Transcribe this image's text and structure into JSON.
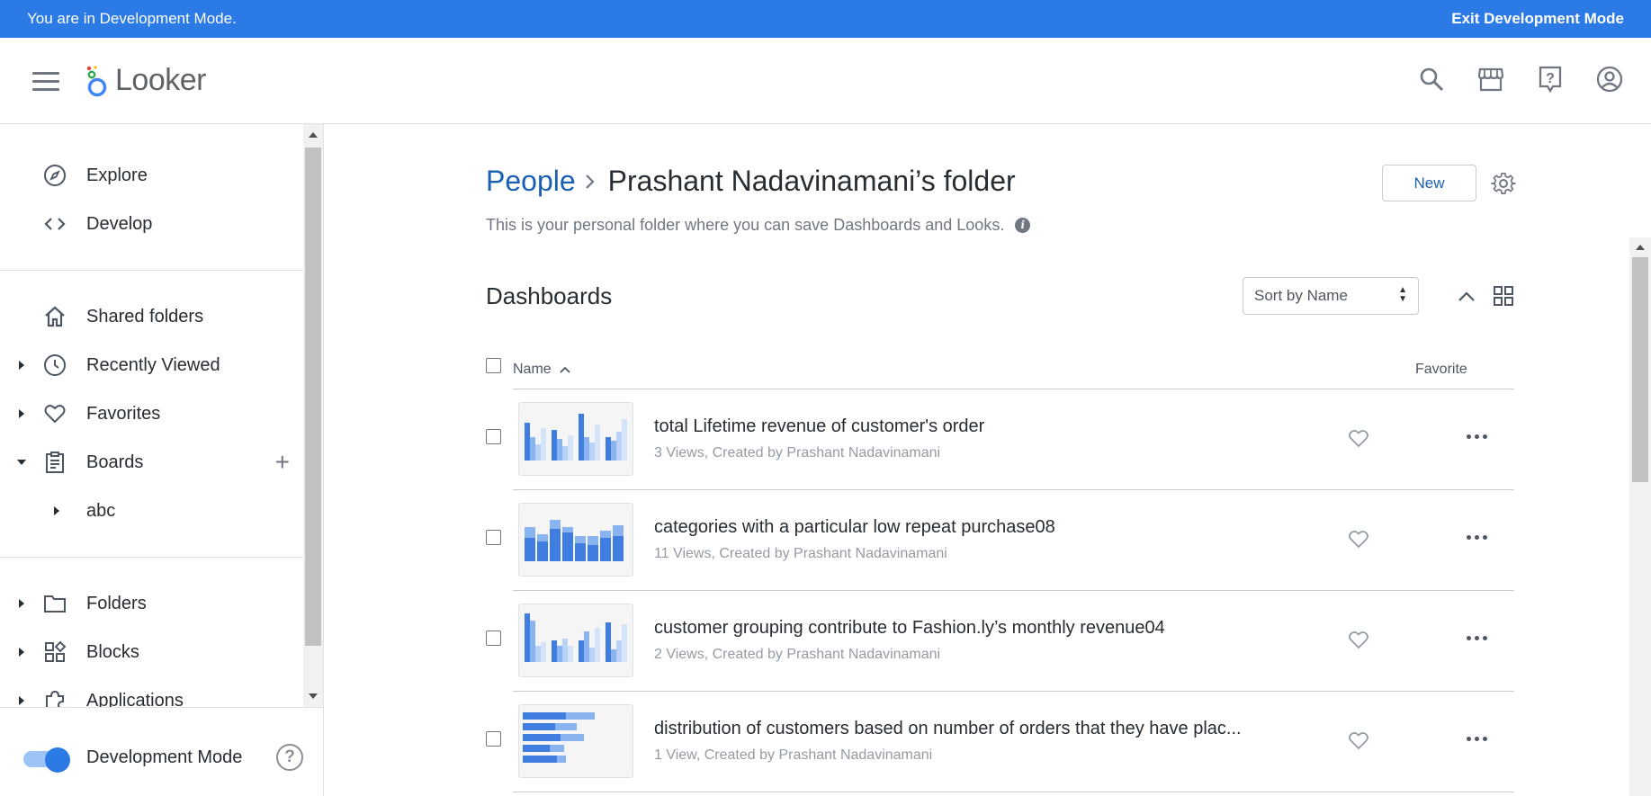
{
  "dev_banner": {
    "message": "You are in Development Mode.",
    "exit_label": "Exit Development Mode"
  },
  "header": {
    "logo_text": "Looker",
    "icons": [
      "search-icon",
      "marketplace-icon",
      "help-icon",
      "account-icon"
    ]
  },
  "sidebar": {
    "primary": [
      {
        "label": "Explore",
        "icon": "compass-icon"
      },
      {
        "label": "Develop",
        "icon": "code-icon"
      }
    ],
    "secondary": [
      {
        "label": "Shared folders",
        "icon": "home-icon"
      },
      {
        "label": "Recently Viewed",
        "icon": "clock-icon"
      },
      {
        "label": "Favorites",
        "icon": "heart-icon"
      },
      {
        "label": "Boards",
        "icon": "clipboard-icon"
      },
      {
        "label": "abc"
      }
    ],
    "tertiary": [
      {
        "label": "Folders",
        "icon": "folder-icon"
      },
      {
        "label": "Blocks",
        "icon": "blocks-icon"
      },
      {
        "label": "Applications",
        "icon": "puzzle-icon"
      }
    ],
    "footer": {
      "dev_mode_label": "Development Mode",
      "dev_mode_on": true
    }
  },
  "main": {
    "breadcrumb_parent": "People",
    "folder_title": "Prashant Nadavinamani’s folder",
    "subtitle": "This is your personal folder where you can save Dashboards and Looks.",
    "new_button": "New",
    "section_title": "Dashboards",
    "sort_value": "Sort by Name",
    "columns": {
      "name": "Name",
      "favorite": "Favorite"
    },
    "accent_color": "#1a5fb4",
    "rows": [
      {
        "title": "total Lifetime revenue of customer's order",
        "meta": "3 Views, Created by Prashant Nadavinamani",
        "thumb": "grouped-bars"
      },
      {
        "title": "categories with a particular low repeat purchase08",
        "meta": "11 Views, Created by Prashant Nadavinamani",
        "thumb": "bars"
      },
      {
        "title": "customer grouping contribute to Fashion.ly’s monthly revenue04",
        "meta": "2 Views, Created by Prashant Nadavinamani",
        "thumb": "grouped-bars"
      },
      {
        "title": "distribution of customers based on number of orders that they have plac...",
        "meta": "1 View, Created by Prashant Nadavinamani",
        "thumb": "horizontal-bars"
      }
    ]
  }
}
